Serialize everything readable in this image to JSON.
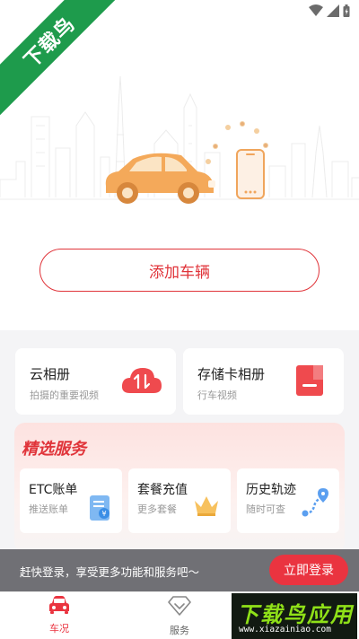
{
  "corner_badge": "下载鸟",
  "actions": {
    "add_vehicle": "添加车辆"
  },
  "albums": [
    {
      "title": "云相册",
      "subtitle": "拍摄的重要视频",
      "icon": "cloud-sync-icon"
    },
    {
      "title": "存储卡相册",
      "subtitle": "行车视频",
      "icon": "sd-card-icon"
    }
  ],
  "services": {
    "title": "精选服务",
    "items": [
      {
        "title": "ETC账单",
        "subtitle": "推送账单",
        "icon": "bill-icon"
      },
      {
        "title": "套餐充值",
        "subtitle": "更多套餐",
        "icon": "crown-icon"
      },
      {
        "title": "历史轨迹",
        "subtitle": "随时可查",
        "icon": "route-icon"
      }
    ]
  },
  "login_prompt": {
    "text": "赶快登录，享受更多功能和服务吧～",
    "button": "立即登录"
  },
  "tabs": [
    {
      "label": "车况",
      "icon": "car-icon",
      "active": true
    },
    {
      "label": "服务",
      "icon": "diamond-icon",
      "active": false
    }
  ],
  "watermark": {
    "brand": "下载鸟应用",
    "url": "www.xiazainiao.com"
  },
  "colors": {
    "accent": "#e0343a",
    "brand_green": "#1e9b4c",
    "car_orange": "#f4a95a"
  }
}
